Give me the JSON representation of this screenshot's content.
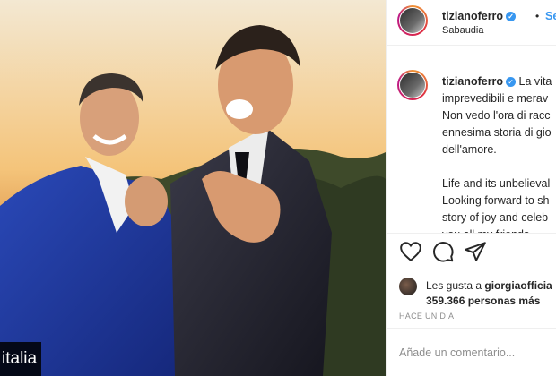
{
  "photo": {
    "alt": "",
    "watermark": "italia"
  },
  "header": {
    "username": "tizianoferro",
    "separator": "•",
    "follow_label": "Segu",
    "location": "Sabaudia"
  },
  "caption": {
    "username": "tizianoferro",
    "lines": [
      "La vita",
      "imprevedibili e merav",
      "Non vedo l'ora di racc",
      "ennesima storia di gio",
      "dell'amore.",
      "—-",
      "Life and its unbelieval",
      "Looking forward to sh",
      "story of joy and celeb",
      "you all my friends .",
      "—-"
    ]
  },
  "actions": {
    "like": "heart-icon",
    "comment": "comment-icon",
    "share": "share-icon"
  },
  "likes": {
    "prefix": "Les gusta a ",
    "user": "giorgiaofficia",
    "count_text": "359.366 personas más"
  },
  "timestamp": "HACE UN DÍA",
  "comment_box": {
    "placeholder": "Añade un comentario..."
  },
  "colors": {
    "accent": "#3897f0",
    "border": "#efefef",
    "muted": "#8e8e8e"
  }
}
